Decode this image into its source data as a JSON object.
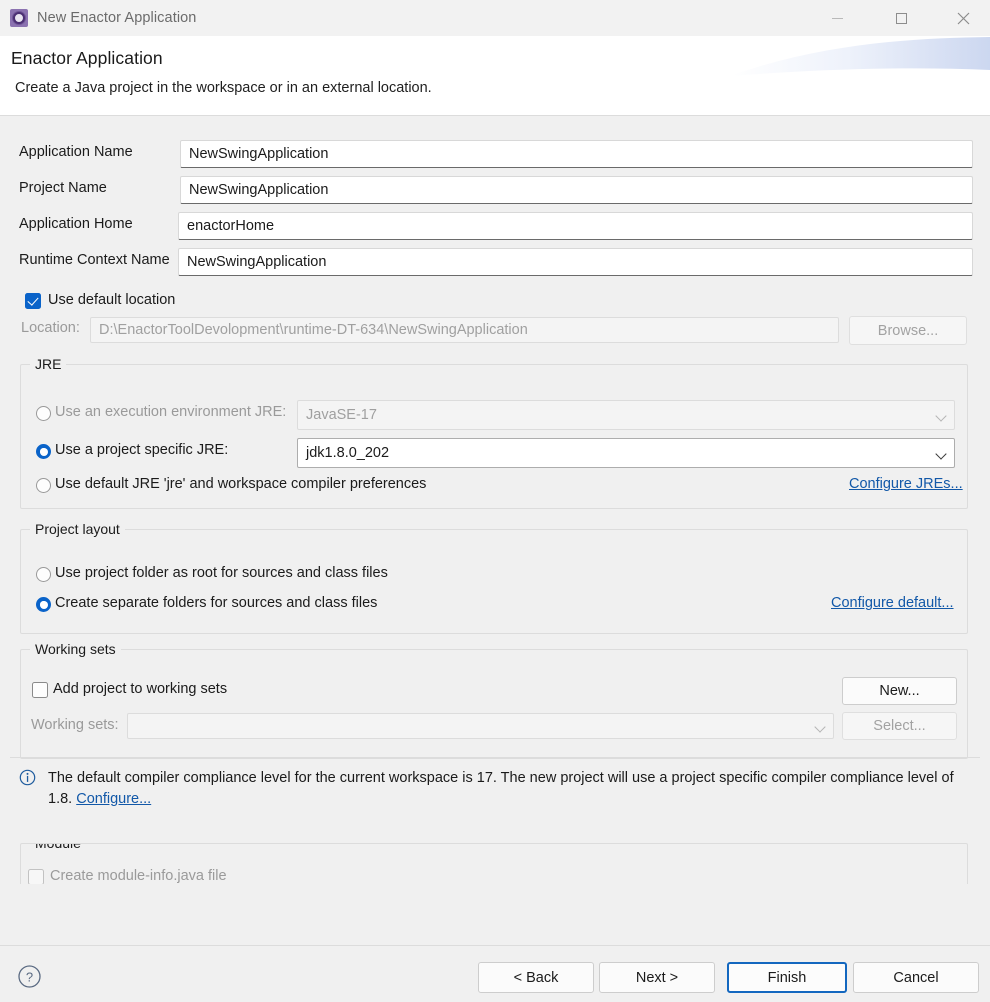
{
  "window": {
    "title": "New Enactor Application",
    "icon": "enactor-cog-icon",
    "controls": {
      "minimize": "minimize-icon",
      "maximize": "maximize-icon",
      "close": "close-icon"
    }
  },
  "header": {
    "title": "Enactor Application",
    "description": "Create a Java project in the workspace or in an external location."
  },
  "form": {
    "fields": [
      {
        "label": "Application Name",
        "value": "NewSwingApplication"
      },
      {
        "label": "Project Name",
        "value": "NewSwingApplication"
      },
      {
        "label": "Application Home",
        "value": "enactorHome"
      },
      {
        "label": "Runtime Context Name",
        "value": "NewSwingApplication"
      }
    ],
    "use_default_location": {
      "label": "Use default location",
      "checked": true
    },
    "location": {
      "label": "Location:",
      "value": "D:\\EnactorToolDevolopment\\runtime-DT-634\\NewSwingApplication",
      "browse_label": "Browse...",
      "enabled": false
    }
  },
  "jre": {
    "group_title": "JRE",
    "option_execution_env": {
      "label": "Use an execution environment JRE:",
      "selected": false,
      "value": "JavaSE-17",
      "enabled": false
    },
    "option_project_jre": {
      "label": "Use a project specific JRE:",
      "selected": true,
      "value": "jdk1.8.0_202",
      "enabled": true
    },
    "option_default_jre": {
      "label": "Use default JRE 'jre' and workspace compiler preferences",
      "selected": false
    },
    "configure_link": "Configure JREs..."
  },
  "project_layout": {
    "group_title": "Project layout",
    "option_root": {
      "label": "Use project folder as root for sources and class files",
      "selected": false
    },
    "option_separate": {
      "label": "Create separate folders for sources and class files",
      "selected": true
    },
    "configure_link": "Configure default..."
  },
  "working_sets": {
    "group_title": "Working sets",
    "add_checkbox": {
      "label": "Add project to working sets",
      "checked": false
    },
    "combo_label": "Working sets:",
    "combo_value": "",
    "new_label": "New...",
    "select_label": "Select..."
  },
  "info": {
    "icon": "info-icon",
    "text_part1": "The default compiler compliance level for the current workspace is 17. The new project will use a project specific compiler compliance level of 1.8. ",
    "link": "Configure..."
  },
  "module": {
    "group_title": "Module",
    "checkbox_label": "Create module-info.java file",
    "checked": false
  },
  "footer": {
    "help_icon": "help-icon",
    "back": "< Back",
    "next": "Next >",
    "finish": "Finish",
    "cancel": "Cancel"
  },
  "colors": {
    "accent": "#0a63c9",
    "link": "#1258a8",
    "focus_border": "#1367bf",
    "window_bg": "#f0f0f0",
    "header_bg": "#ffffff"
  }
}
